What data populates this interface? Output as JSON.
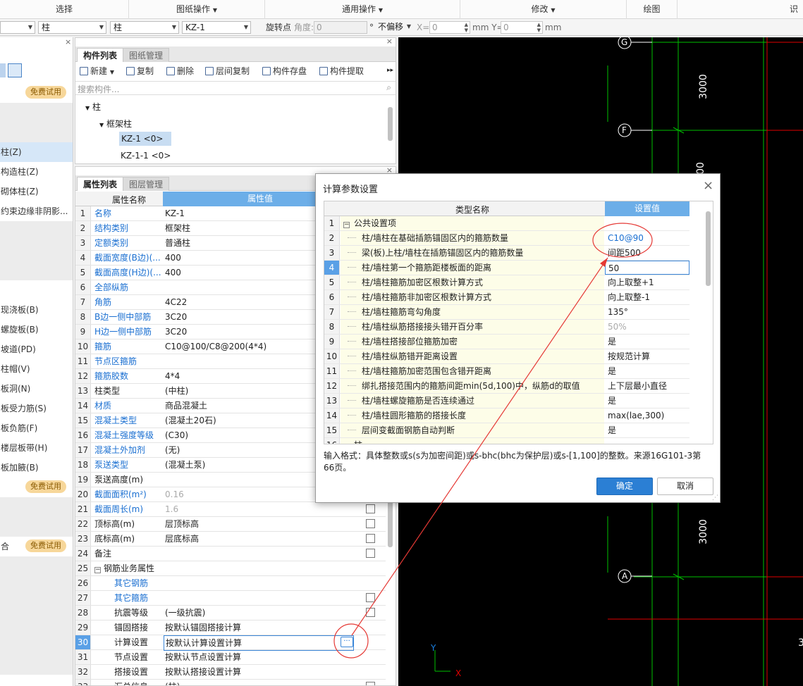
{
  "ribbon": {
    "groups": [
      "选择",
      "图纸操作",
      "通用操作",
      "修改",
      "绘图",
      "识"
    ]
  },
  "toolbar": {
    "combo1": "",
    "combo2": "柱",
    "combo3": "柱",
    "combo4": "KZ-1",
    "rotate_label": "旋转点",
    "angle_label": "角度:",
    "angle_value": "0",
    "angle_unit": "°",
    "offset": "不偏移",
    "x_label": "X=",
    "x_value": "0",
    "y_label": "mm Y=",
    "y_value": "0",
    "y_unit": "mm"
  },
  "leftnav": {
    "items": [
      "免费试用",
      "柱(Z)",
      "构造柱(Z)",
      "砌体柱(Z)",
      "约束边缘非阴影...",
      "现浇板(B)",
      "螺旋板(B)",
      "坡道(PD)",
      "柱帽(V)",
      "板洞(N)",
      "板受力筋(S)",
      "板负筋(F)",
      "楼层板带(H)",
      "板加腋(B)",
      "免费试用",
      "免费试用"
    ]
  },
  "component_panel": {
    "tabs": [
      "构件列表",
      "图纸管理"
    ],
    "buttons": [
      "新建",
      "复制",
      "删除",
      "层间复制",
      "构件存盘",
      "构件提取"
    ],
    "search_placeholder": "搜索构件...",
    "tree": [
      "柱",
      "框架柱",
      "KZ-1 <0>",
      "KZ-1-1 <0>"
    ]
  },
  "props_panel": {
    "tabs": [
      "属性列表",
      "图层管理"
    ],
    "col_name": "属性名称",
    "col_value": "属性值",
    "rows": [
      {
        "n": "1",
        "k": "名称",
        "v": "KZ-1"
      },
      {
        "n": "2",
        "k": "结构类别",
        "v": "框架柱"
      },
      {
        "n": "3",
        "k": "定额类别",
        "v": "普通柱"
      },
      {
        "n": "4",
        "k": "截面宽度(B边)(...",
        "v": "400"
      },
      {
        "n": "5",
        "k": "截面高度(H边)(...",
        "v": "400"
      },
      {
        "n": "6",
        "k": "全部纵筋",
        "v": ""
      },
      {
        "n": "7",
        "k": "角筋",
        "v": "4C22"
      },
      {
        "n": "8",
        "k": "B边一侧中部筋",
        "v": "3C20"
      },
      {
        "n": "9",
        "k": "H边一侧中部筋",
        "v": "3C20"
      },
      {
        "n": "10",
        "k": "箍筋",
        "v": "C10@100/C8@200(4*4)"
      },
      {
        "n": "11",
        "k": "节点区箍筋",
        "v": ""
      },
      {
        "n": "12",
        "k": "箍筋胶数",
        "v": "4*4"
      },
      {
        "n": "13",
        "k": "柱类型",
        "v": "(中柱)"
      },
      {
        "n": "14",
        "k": "材质",
        "v": "商品混凝土"
      },
      {
        "n": "15",
        "k": "混凝土类型",
        "v": "(混凝土20石)"
      },
      {
        "n": "16",
        "k": "混凝土强度等级",
        "v": "(C30)"
      },
      {
        "n": "17",
        "k": "混凝土外加剂",
        "v": "(无)"
      },
      {
        "n": "18",
        "k": "泵送类型",
        "v": "(混凝土泵)"
      },
      {
        "n": "19",
        "k": "泵送高度(m)",
        "v": ""
      },
      {
        "n": "20",
        "k": "截面面积(m²)",
        "v": "0.16"
      },
      {
        "n": "21",
        "k": "截面周长(m)",
        "v": "1.6"
      },
      {
        "n": "22",
        "k": "顶标高(m)",
        "v": "层顶标高"
      },
      {
        "n": "23",
        "k": "底标高(m)",
        "v": "层底标高"
      },
      {
        "n": "24",
        "k": "备注",
        "v": ""
      },
      {
        "n": "25",
        "k": "钢筋业务属性",
        "v": ""
      },
      {
        "n": "26",
        "k": "其它钢筋",
        "v": ""
      },
      {
        "n": "27",
        "k": "其它箍筋",
        "v": ""
      },
      {
        "n": "28",
        "k": "抗震等级",
        "v": "(一级抗震)"
      },
      {
        "n": "29",
        "k": "锚固搭接",
        "v": "按默认锚固搭接计算"
      },
      {
        "n": "30",
        "k": "计算设置",
        "v": "按默认计算设置计算"
      },
      {
        "n": "31",
        "k": "节点设置",
        "v": "按默认节点设置计算"
      },
      {
        "n": "32",
        "k": "搭接设置",
        "v": "按默认搭接设置计算"
      },
      {
        "n": "33",
        "k": "汇总信息",
        "v": "(柱)"
      }
    ],
    "dots": "···"
  },
  "canvas": {
    "axes": [
      "G",
      "F",
      "A"
    ],
    "dims": [
      "3000",
      "00",
      "3000",
      "3"
    ],
    "x_axis": "X",
    "y_axis": "Y"
  },
  "dialog": {
    "title": "计算参数设置",
    "close": "×",
    "col_type": "类型名称",
    "col_value": "设置值",
    "rows": [
      {
        "n": "1",
        "k": "公共设置项",
        "v": ""
      },
      {
        "n": "2",
        "k": "柱/墙柱在基础插筋锚固区内的箍筋数量",
        "v": "C10@90"
      },
      {
        "n": "3",
        "k": "梁(板)上柱/墙柱在插筋锚固区内的箍筋数量",
        "v": "间距500"
      },
      {
        "n": "4",
        "k": "柱/墙柱第一个箍筋距楼板面的距离",
        "v": "50"
      },
      {
        "n": "5",
        "k": "柱/墙柱箍筋加密区根数计算方式",
        "v": "向上取整+1"
      },
      {
        "n": "6",
        "k": "柱/墙柱箍筋非加密区根数计算方式",
        "v": "向上取整-1"
      },
      {
        "n": "7",
        "k": "柱/墙柱箍筋弯勾角度",
        "v": "135°"
      },
      {
        "n": "8",
        "k": "柱/墙柱纵筋搭接接头错开百分率",
        "v": "50%"
      },
      {
        "n": "9",
        "k": "柱/墙柱搭接部位箍筋加密",
        "v": "是"
      },
      {
        "n": "10",
        "k": "柱/墙柱纵筋错开距离设置",
        "v": "按规范计算"
      },
      {
        "n": "11",
        "k": "柱/墙柱箍筋加密范围包含错开距离",
        "v": "是"
      },
      {
        "n": "12",
        "k": "绑扎搭接范围内的箍筋间距min(5d,100)中，纵筋d的取值",
        "v": "上下层最小直径"
      },
      {
        "n": "13",
        "k": "柱/墙柱螺旋箍筋是否连续通过",
        "v": "是"
      },
      {
        "n": "14",
        "k": "柱/墙柱圆形箍筋的搭接长度",
        "v": "max(lae,300)"
      },
      {
        "n": "15",
        "k": "层间变截面钢筋自动判断",
        "v": "是"
      },
      {
        "n": "16",
        "k": "柱",
        "v": ""
      }
    ],
    "hint": "输入格式：具体整数或s(s为加密间距)或s-bhc(bhc为保护层)或s-[1,100]的整数。来源16G101-3第66页。",
    "ok": "确定",
    "cancel": "取消"
  }
}
